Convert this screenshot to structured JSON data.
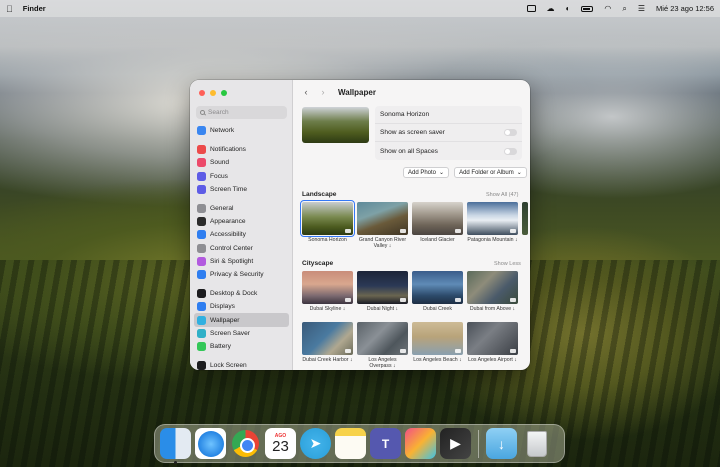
{
  "menubar": {
    "app_name": "Finder",
    "datetime": "Mié 23 ago 12:56"
  },
  "window": {
    "title": "Wallpaper",
    "search_placeholder": "Search",
    "sidebar": [
      {
        "label": "Network",
        "icon": "network-icon",
        "color": "#3a86f0"
      },
      {
        "label": "Notifications",
        "icon": "notifications-icon",
        "color": "#ec4a4a"
      },
      {
        "label": "Sound",
        "icon": "sound-icon",
        "color": "#ec4a6a"
      },
      {
        "label": "Focus",
        "icon": "focus-icon",
        "color": "#5e5ce6"
      },
      {
        "label": "Screen Time",
        "icon": "screen-time-icon",
        "color": "#5e5ce6"
      },
      {
        "label": "General",
        "icon": "gear-icon",
        "color": "#8e8e93"
      },
      {
        "label": "Appearance",
        "icon": "appearance-icon",
        "color": "#2b2b2b"
      },
      {
        "label": "Accessibility",
        "icon": "accessibility-icon",
        "color": "#2f7ef0"
      },
      {
        "label": "Control Center",
        "icon": "control-center-icon",
        "color": "#8e8e93"
      },
      {
        "label": "Siri & Spotlight",
        "icon": "siri-icon",
        "color": "#b25adf"
      },
      {
        "label": "Privacy & Security",
        "icon": "privacy-icon",
        "color": "#2f7ef0"
      },
      {
        "label": "Desktop & Dock",
        "icon": "desktop-dock-icon",
        "color": "#1c1c1e"
      },
      {
        "label": "Displays",
        "icon": "displays-icon",
        "color": "#2f7ef0"
      },
      {
        "label": "Wallpaper",
        "icon": "wallpaper-icon",
        "color": "#30b0e0",
        "active": true
      },
      {
        "label": "Screen Saver",
        "icon": "screen-saver-icon",
        "color": "#30b0c7"
      },
      {
        "label": "Battery",
        "icon": "battery-icon",
        "color": "#34c759"
      },
      {
        "label": "Lock Screen",
        "icon": "lock-icon",
        "color": "#1c1c1e"
      }
    ],
    "current_wallpaper": "Sonoma Horizon",
    "option_screensaver": "Show as screen saver",
    "option_all_spaces": "Show on all Spaces",
    "add_photo": "Add Photo",
    "add_folder": "Add Folder or Album",
    "landscape_title": "Landscape",
    "landscape_link": "Show All (47)",
    "cityscape_title": "Cityscape",
    "cityscape_link": "Show Less",
    "landscape": [
      "Sonoma Horizon",
      "Grand Canyon River Valley ↓",
      "Iceland Glacier",
      "Patagonia Mountain ↓"
    ],
    "cityscape_row1": [
      "Dubai Skyline ↓",
      "Dubai Night ↓",
      "Dubai Creek",
      "Dubai from Above ↓"
    ],
    "cityscape_row2": [
      "Dubai Creek Harbor ↓",
      "Los Angeles Overpass ↓",
      "Los Angeles Beach ↓",
      "Los Angeles Airport ↓"
    ]
  },
  "dock": {
    "apps": [
      "Finder",
      "Safari",
      "Google Chrome",
      "Calendar",
      "Telegram",
      "Notes",
      "Microsoft Teams",
      "Pixelmator Pro",
      "Final Cut Pro",
      "Downloads",
      "Trash"
    ],
    "calendar_month": "AGO",
    "calendar_day": "23",
    "teams_letter": "T"
  }
}
